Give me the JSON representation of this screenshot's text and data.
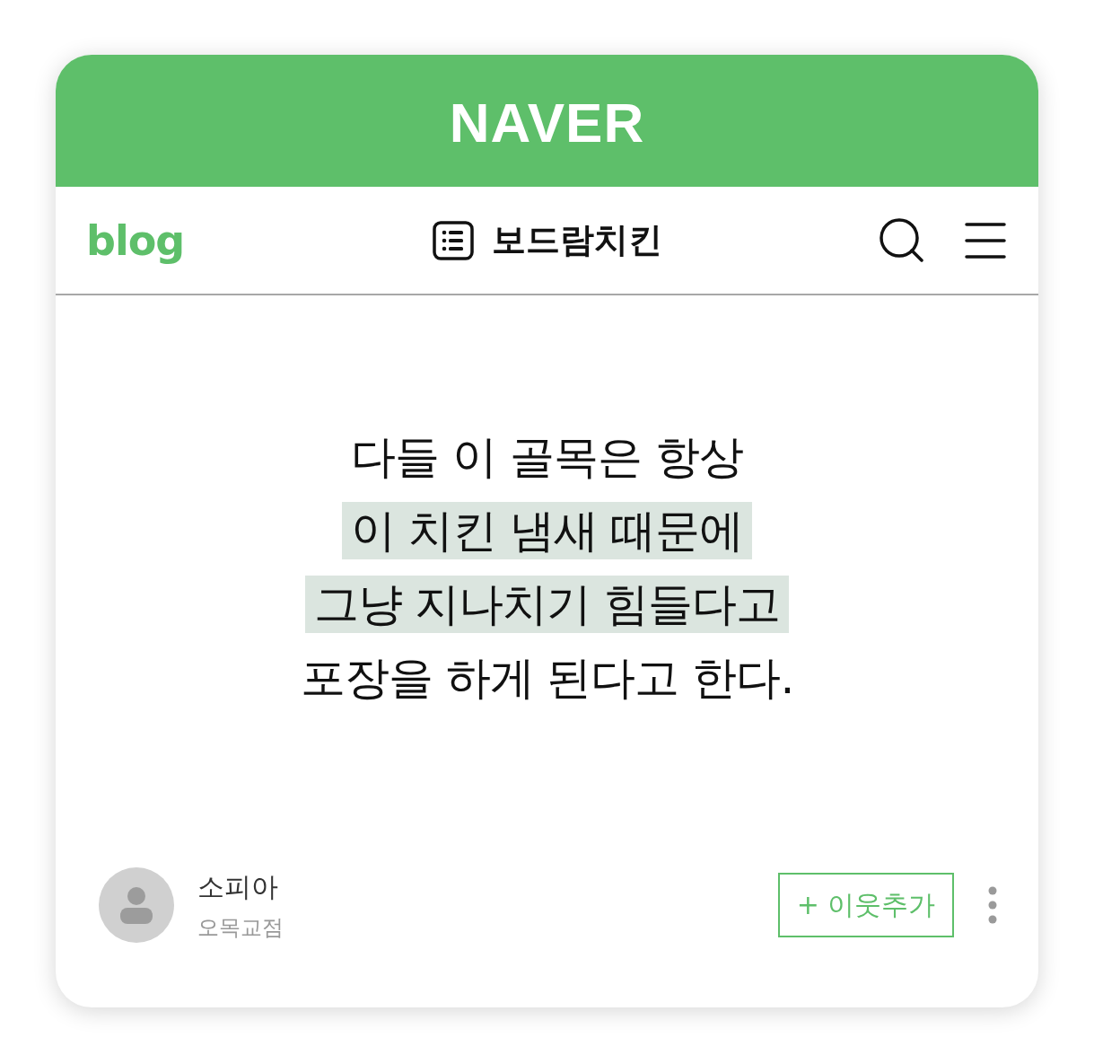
{
  "header": {
    "logo": "NAVER"
  },
  "nav": {
    "logo": "blog",
    "blog_title": "보드람치킨"
  },
  "post": {
    "lines": [
      {
        "text": "다들 이 골목은 항상",
        "highlighted": false
      },
      {
        "text": "이 치킨 냄새 때문에",
        "highlighted": true
      },
      {
        "text": "그냥 지나치기 힘들다고",
        "highlighted": true
      },
      {
        "text": "포장을 하게 된다고 한다.",
        "highlighted": false
      }
    ]
  },
  "author": {
    "name": "소피아",
    "subtitle": "오목교점",
    "button": "+ 이웃추가"
  }
}
